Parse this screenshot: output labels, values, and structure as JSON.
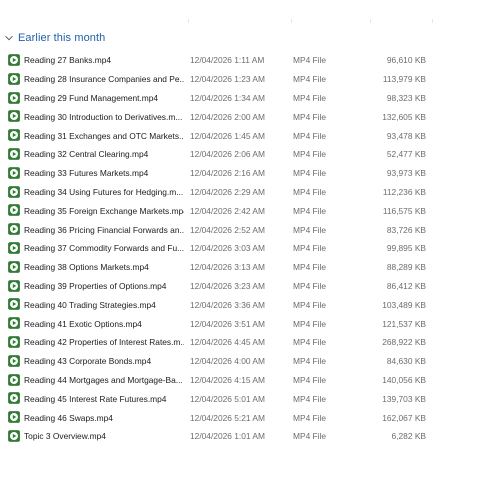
{
  "group": {
    "title": "Earlier this month"
  },
  "files": [
    {
      "name": "Reading 27 Banks.mp4",
      "date": "12/04/2026 1:11 AM",
      "type": "MP4 File",
      "size": "96,610 KB"
    },
    {
      "name": "Reading 28 Insurance Companies and Pe...",
      "date": "12/04/2026 1:23 AM",
      "type": "MP4 File",
      "size": "113,979 KB"
    },
    {
      "name": "Reading 29 Fund Management.mp4",
      "date": "12/04/2026 1:34 AM",
      "type": "MP4 File",
      "size": "98,323 KB"
    },
    {
      "name": "Reading 30 Introduction to Derivatives.m...",
      "date": "12/04/2026 2:00 AM",
      "type": "MP4 File",
      "size": "132,605 KB"
    },
    {
      "name": "Reading 31 Exchanges and OTC Markets....",
      "date": "12/04/2026 1:45 AM",
      "type": "MP4 File",
      "size": "93,478 KB"
    },
    {
      "name": "Reading 32 Central Clearing.mp4",
      "date": "12/04/2026 2:06 AM",
      "type": "MP4 File",
      "size": "52,477 KB"
    },
    {
      "name": "Reading 33 Futures Markets.mp4",
      "date": "12/04/2026 2:16 AM",
      "type": "MP4 File",
      "size": "93,973 KB"
    },
    {
      "name": "Reading 34 Using Futures for Hedging.m...",
      "date": "12/04/2026 2:29 AM",
      "type": "MP4 File",
      "size": "112,236 KB"
    },
    {
      "name": "Reading 35 Foreign Exchange Markets.mp4",
      "date": "12/04/2026 2:42 AM",
      "type": "MP4 File",
      "size": "116,575 KB"
    },
    {
      "name": "Reading 36 Pricing Financial Forwards an...",
      "date": "12/04/2026 2:52 AM",
      "type": "MP4 File",
      "size": "83,726 KB"
    },
    {
      "name": "Reading 37 Commodity Forwards and Fu...",
      "date": "12/04/2026 3:03 AM",
      "type": "MP4 File",
      "size": "99,895 KB"
    },
    {
      "name": "Reading 38 Options Markets.mp4",
      "date": "12/04/2026 3:13 AM",
      "type": "MP4 File",
      "size": "88,289 KB"
    },
    {
      "name": "Reading 39 Properties of Options.mp4",
      "date": "12/04/2026 3:23 AM",
      "type": "MP4 File",
      "size": "86,412 KB"
    },
    {
      "name": "Reading 40 Trading Strategies.mp4",
      "date": "12/04/2026 3:36 AM",
      "type": "MP4 File",
      "size": "103,489 KB"
    },
    {
      "name": "Reading 41 Exotic Options.mp4",
      "date": "12/04/2026 3:51 AM",
      "type": "MP4 File",
      "size": "121,537 KB"
    },
    {
      "name": "Reading 42 Properties of Interest Rates.m...",
      "date": "12/04/2026 4:45 AM",
      "type": "MP4 File",
      "size": "268,922 KB"
    },
    {
      "name": "Reading 43 Corporate Bonds.mp4",
      "date": "12/04/2026 4:00 AM",
      "type": "MP4 File",
      "size": "84,630 KB"
    },
    {
      "name": "Reading 44 Mortgages and Mortgage-Ba...",
      "date": "12/04/2026 4:15 AM",
      "type": "MP4 File",
      "size": "140,056 KB"
    },
    {
      "name": "Reading 45 Interest Rate Futures.mp4",
      "date": "12/04/2026 5:01 AM",
      "type": "MP4 File",
      "size": "139,703 KB"
    },
    {
      "name": "Reading 46 Swaps.mp4",
      "date": "12/04/2026 5:21 AM",
      "type": "MP4 File",
      "size": "162,067 KB"
    },
    {
      "name": "Topic 3 Overview.mp4",
      "date": "12/04/2026 1:01 AM",
      "type": "MP4 File",
      "size": "6,282 KB"
    }
  ]
}
